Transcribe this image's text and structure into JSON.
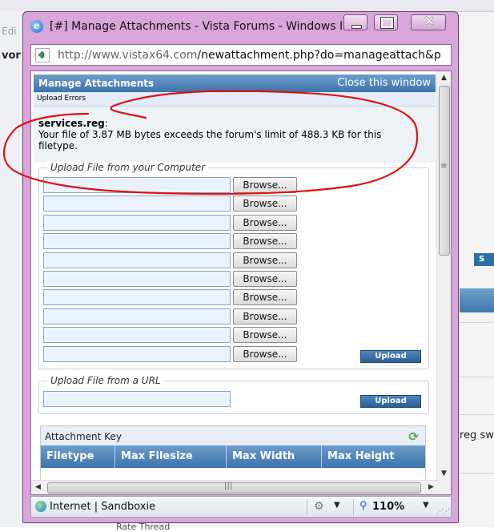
{
  "background": {
    "left_label_top": "Edi",
    "left_label_bold": "vor",
    "right_button": "S",
    "right_text": "reg sw",
    "bottom_text": "Rate Thread"
  },
  "window": {
    "title": "[#] Manage Attachments - Vista Forums - Windows Int...",
    "address_host": "http://www.vistax64.com",
    "address_path": "/newattachment.php?do=manageattach&p",
    "buttons": {
      "minimize": "minimize",
      "maximize": "maximize",
      "close": "✕"
    }
  },
  "panel": {
    "title": "Manage Attachments",
    "close_link": "Close this window",
    "errors_label": "Upload Errors",
    "error_filename": "services.reg",
    "error_suffix": ":",
    "error_message": "Your file of 3.87 MB bytes exceeds the forum's limit of 488.3 KB for this filetype."
  },
  "upload_computer": {
    "legend": "Upload File from your Computer",
    "browse_label": "Browse...",
    "rows": 10,
    "upload_label": "Upload"
  },
  "upload_url": {
    "legend": "Upload File from a URL",
    "upload_label": "Upload"
  },
  "attachment_key": {
    "title": "Attachment Key",
    "columns": [
      "Filetype",
      "Max Filesize",
      "Max Width",
      "Max Height"
    ]
  },
  "statusbar": {
    "zone": "Internet | Sandboxie",
    "zoom": "110%"
  },
  "colors": {
    "window_frame": "#d8a6da",
    "header_blue": "#3c74ab",
    "annotation_red": "#e01010"
  }
}
